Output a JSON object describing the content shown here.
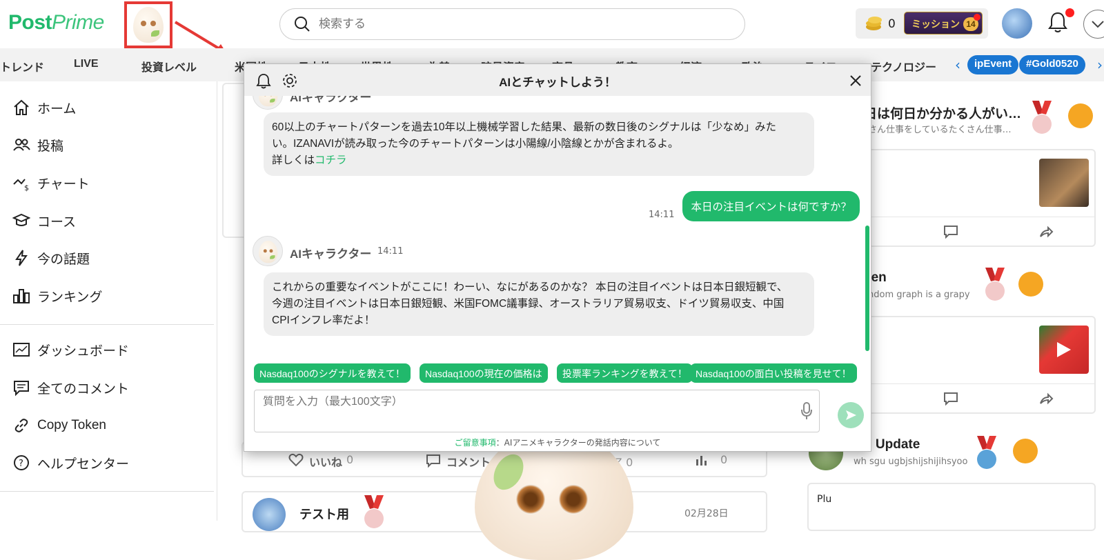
{
  "header": {
    "logo_post": "Post",
    "logo_prime": "Prime",
    "search_placeholder": "検索する",
    "coin_count": "0",
    "mission_label": "ミッション",
    "mission_badge": "14"
  },
  "categories": [
    "トレンド",
    "LIVE",
    "投資レベル",
    "米国株",
    "日本株",
    "世界株",
    "為替",
    "暗号資産",
    "商品",
    "教育",
    "経済",
    "政治",
    "ライフ",
    "テクノロジー"
  ],
  "tags": [
    "ipEvent",
    "#Gold0520"
  ],
  "sidebar": {
    "items": [
      {
        "label": "ホーム",
        "icon": "home-icon"
      },
      {
        "label": "投稿",
        "icon": "users-icon"
      },
      {
        "label": "チャート",
        "icon": "chart-icon"
      },
      {
        "label": "コース",
        "icon": "graduation-cap-icon"
      },
      {
        "label": "今の話題",
        "icon": "lightning-icon"
      },
      {
        "label": "ランキング",
        "icon": "ranking-icon"
      }
    ],
    "items2": [
      {
        "label": "ダッシュボード",
        "icon": "dashboard-icon"
      },
      {
        "label": "全てのコメント",
        "icon": "comment-icon"
      },
      {
        "label": "Copy Token",
        "icon": "link-icon"
      },
      {
        "label": "ヘルプセンター",
        "icon": "help-icon"
      }
    ]
  },
  "feed": {
    "like_label": "いいね",
    "like_count": "0",
    "comment_label": "コメント",
    "share_count_partial": "ェア 0",
    "views_count": "0",
    "post_author_partial": "テスト用",
    "post_date_partial": "02月28日"
  },
  "right_col": {
    "q_title": "日は何日か分かる人がい…",
    "q_sub": "さん仕事をしているたくさん仕事…",
    "user2_name": "yen",
    "user2_sub": "ndom graph is a grapy",
    "user3_name": "p Update",
    "user3_sub": "wh sgu ugbjshijshijihsyoo",
    "input_partial": "Plu"
  },
  "modal": {
    "title": "AIとチャットしよう！",
    "top_partial_name": "AIキャラクター",
    "msg1_line1": "60以上のチャートパターンを過去10年以上機械学習した結果、最新の数日後のシグナルは「少なめ」みた",
    "msg1_line2": "い。IZANAVIが読み取った今のチャートパターンは小陽線/小陰線とかが含まれるよ。",
    "msg1_line3": "詳しくは",
    "msg1_link": "コチラ",
    "user_msg": "本日の注目イベントは何ですか？",
    "user_time": "14:11",
    "bot_name": "AIキャラクター",
    "bot_time": "14:11",
    "msg2_line1": "これからの重要なイベントがここに！わーい、なにがあるのかな？ 本日の注目イベントは日本日銀短観で、",
    "msg2_line2": "今週の注目イベントは日本日銀短観、米国FOMC議事録、オーストラリア貿易収支、ドイツ貿易収支、中国",
    "msg2_line3": "CPIインフレ率だよ！",
    "suggestions": [
      "Nasdaq100のシグナルを教えて！",
      "Nasdaq100の現在の価格は",
      "投票率ランキングを教えて！",
      "Nasdaq100の面白い投稿を見せて！"
    ],
    "input_placeholder": "質問を入力（最大100文字）",
    "notice_strong": "ご留意事項",
    "notice_rest": "：AIアニメキャラクターの発話内容について"
  },
  "colors": {
    "brand_green": "#21b96c",
    "highlight_red": "#e53935",
    "tag_blue": "#1976d2"
  }
}
